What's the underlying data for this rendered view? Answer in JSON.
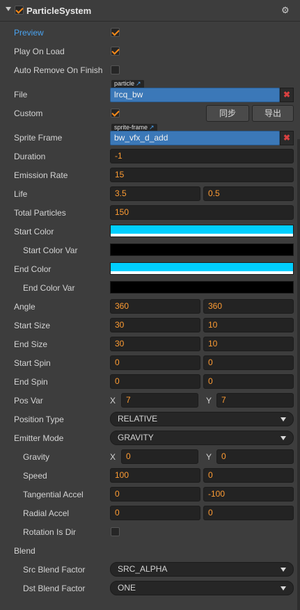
{
  "header": {
    "title": "ParticleSystem",
    "enabled": true,
    "gear_icon": "gear-icon"
  },
  "preview": {
    "label": "Preview",
    "checked": true
  },
  "play_on_load": {
    "label": "Play On Load",
    "checked": true
  },
  "auto_remove": {
    "label": "Auto Remove On Finish",
    "checked": false
  },
  "file": {
    "label": "File",
    "tag": "particle",
    "value": "lrcq_bw",
    "clear": "✖"
  },
  "custom": {
    "label": "Custom",
    "checked": true,
    "sync_button": "同步",
    "export_button": "导出"
  },
  "sprite_frame": {
    "label": "Sprite Frame",
    "tag": "sprite-frame",
    "value": "bw_vfx_d_add",
    "clear": "✖"
  },
  "duration": {
    "label": "Duration",
    "value": "-1"
  },
  "emission_rate": {
    "label": "Emission Rate",
    "value": "15"
  },
  "life": {
    "label": "Life",
    "value": "3.5",
    "var": "0.5"
  },
  "total_particles": {
    "label": "Total Particles",
    "value": "150"
  },
  "start_color": {
    "label": "Start Color",
    "color": "#00cfff"
  },
  "start_color_var": {
    "label": "Start Color Var",
    "color": "#000000"
  },
  "end_color": {
    "label": "End Color",
    "color": "#00cfff"
  },
  "end_color_var": {
    "label": "End Color Var",
    "color": "#000000"
  },
  "angle": {
    "label": "Angle",
    "value": "360",
    "var": "360"
  },
  "start_size": {
    "label": "Start Size",
    "value": "30",
    "var": "10"
  },
  "end_size": {
    "label": "End Size",
    "value": "30",
    "var": "10"
  },
  "start_spin": {
    "label": "Start Spin",
    "value": "0",
    "var": "0"
  },
  "end_spin": {
    "label": "End Spin",
    "value": "0",
    "var": "0"
  },
  "pos_var": {
    "label": "Pos Var",
    "x_label": "X",
    "x": "7",
    "y_label": "Y",
    "y": "7"
  },
  "position_type": {
    "label": "Position Type",
    "value": "RELATIVE"
  },
  "emitter_mode": {
    "label": "Emitter Mode",
    "value": "GRAVITY"
  },
  "gravity": {
    "label": "Gravity",
    "x_label": "X",
    "x": "0",
    "y_label": "Y",
    "y": "0"
  },
  "speed": {
    "label": "Speed",
    "value": "100",
    "var": "0"
  },
  "tangential_accel": {
    "label": "Tangential Accel",
    "value": "0",
    "var": "-100"
  },
  "radial_accel": {
    "label": "Radial Accel",
    "value": "0",
    "var": "0"
  },
  "rotation_is_dir": {
    "label": "Rotation Is Dir",
    "checked": false
  },
  "blend": {
    "label": "Blend"
  },
  "src_blend": {
    "label": "Src Blend Factor",
    "value": "SRC_ALPHA"
  },
  "dst_blend": {
    "label": "Dst Blend Factor",
    "value": "ONE"
  },
  "colors": {
    "accent": "#ff8c1a",
    "link_blue": "#4aa3f0",
    "asset_blue": "#3b78b8"
  }
}
